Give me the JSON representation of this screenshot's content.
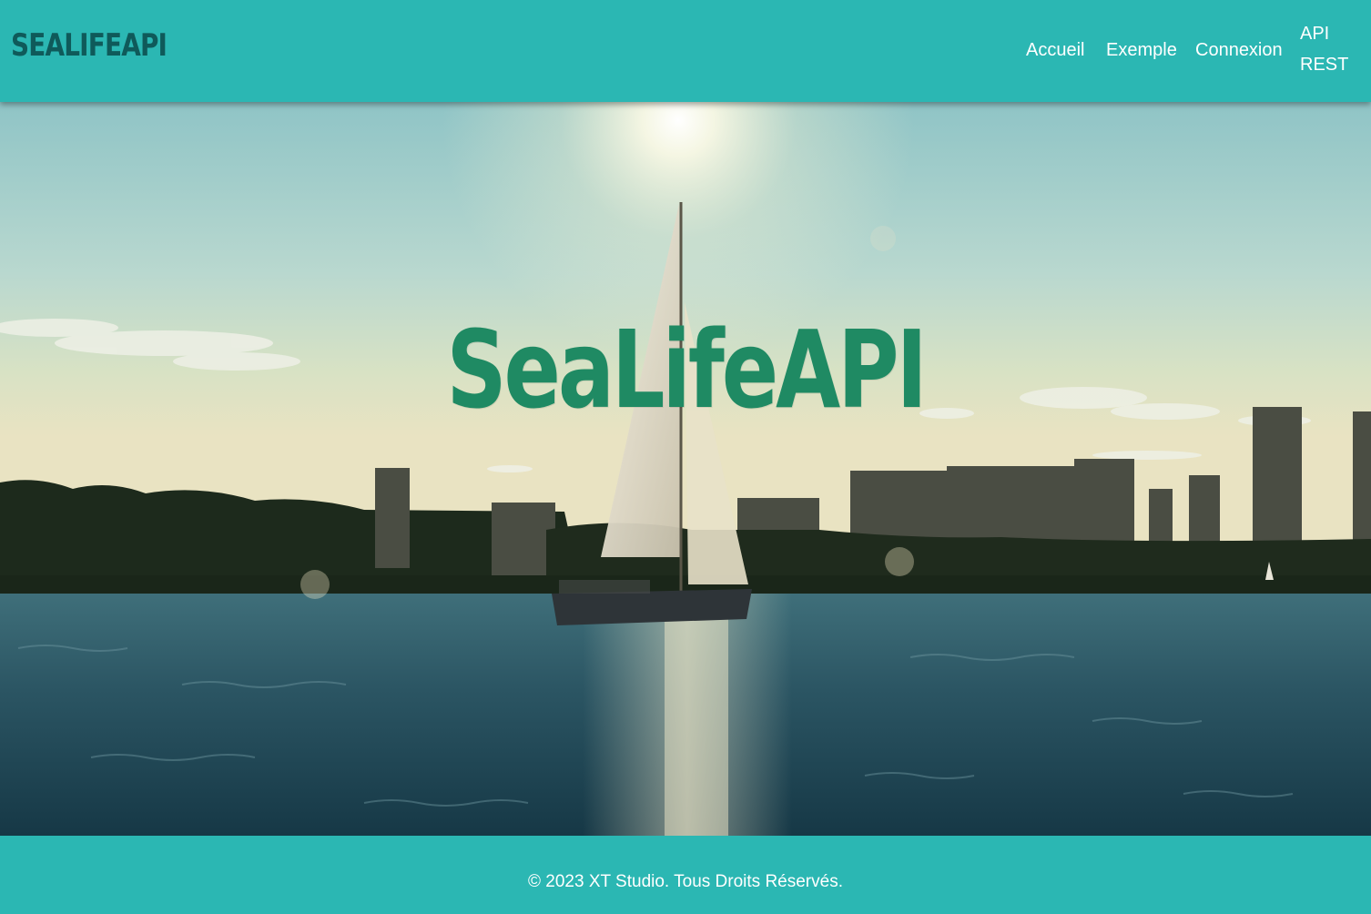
{
  "header": {
    "logo_text": "SEALIFEAPI",
    "nav": {
      "accueil": "Accueil",
      "exemple": "Exemple",
      "connexion": "Connexion",
      "api_rest": "API REST"
    }
  },
  "hero": {
    "title": "SeaLifeAPI"
  },
  "footer": {
    "copyright": "© 2023 XT Studio. Tous Droits Réservés."
  },
  "colors": {
    "brand_teal": "#2bb7b3",
    "logo_dark_teal": "#0f5a5a",
    "hero_title_green": "#1f8a63"
  }
}
